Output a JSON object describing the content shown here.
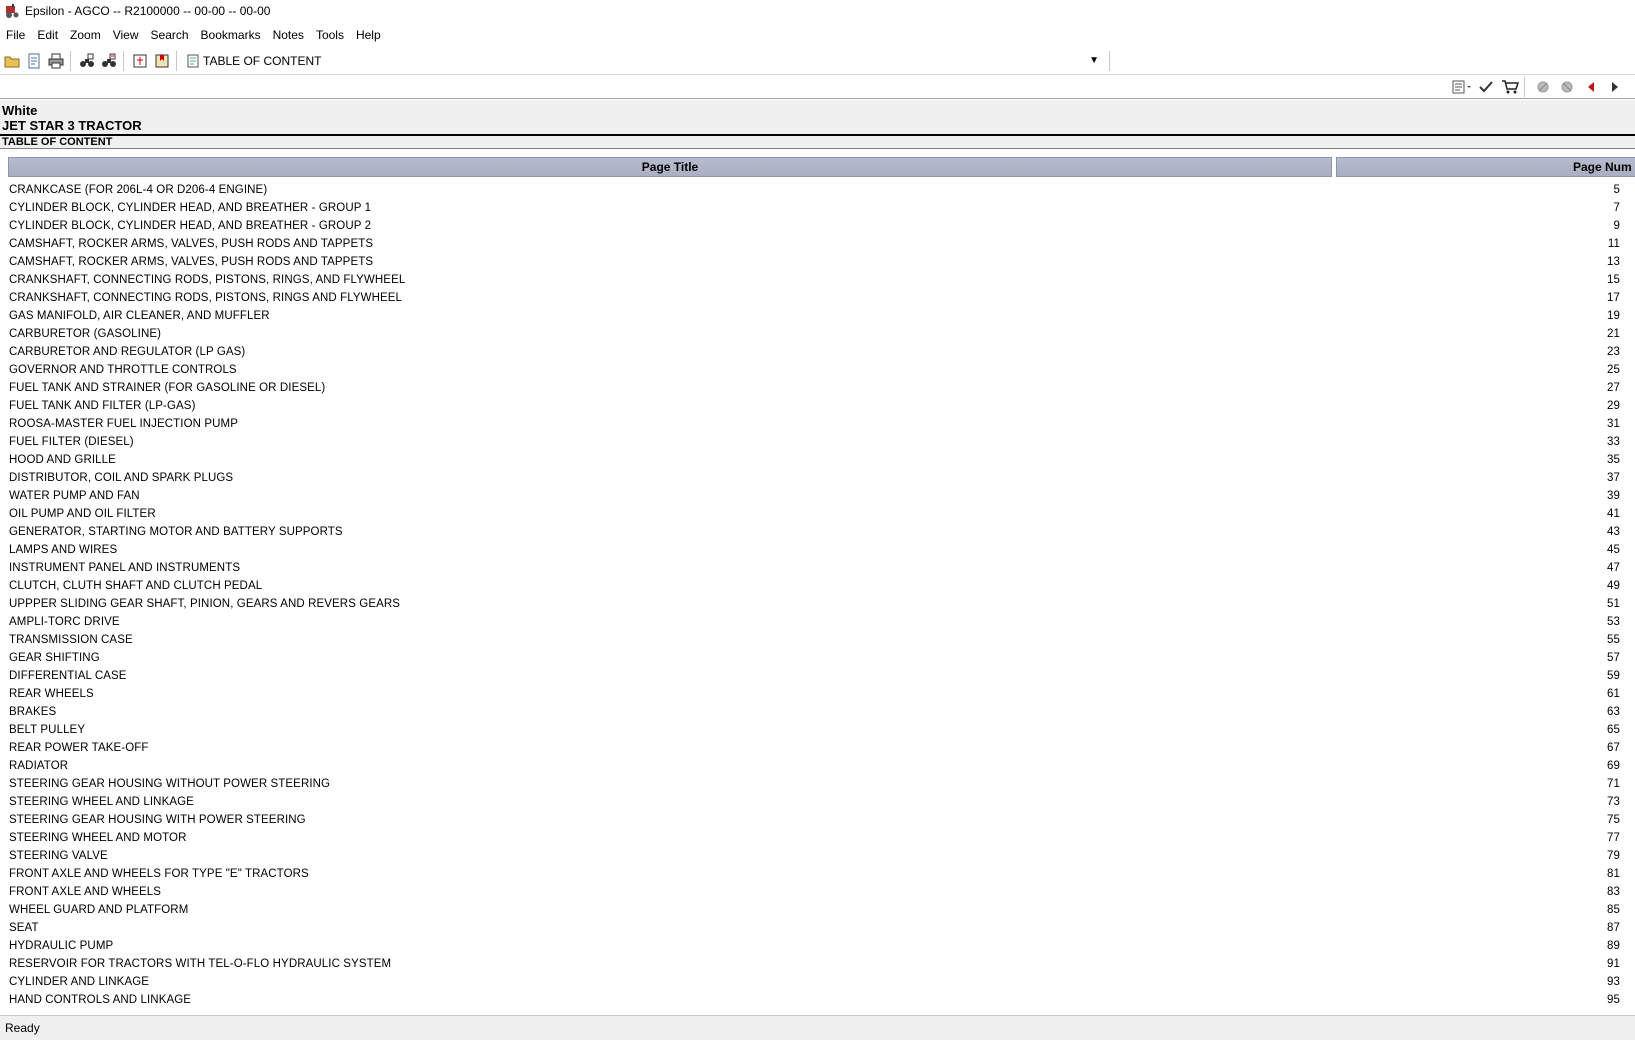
{
  "window": {
    "title": "Epsilon - AGCO -- R2100000 -- 00-00 -- 00-00"
  },
  "menu": [
    {
      "label": "File"
    },
    {
      "label": "Edit"
    },
    {
      "label": "Zoom"
    },
    {
      "label": "View"
    },
    {
      "label": "Search"
    },
    {
      "label": "Bookmarks"
    },
    {
      "label": "Notes"
    },
    {
      "label": "Tools"
    },
    {
      "label": "Help"
    }
  ],
  "toolbar": {
    "document_selector": "TABLE OF CONTENT",
    "icons": [
      "open-folder-icon",
      "save-icon",
      "print-icon",
      "binoculars-icon",
      "binoculars-next-icon",
      "book-icon",
      "bookmark-book-icon"
    ]
  },
  "nav_toolbar": {
    "icons": [
      "notes-dropdown-icon",
      "check-icon",
      "cart-icon",
      "parts-disabled-icon",
      "parts-disabled-2-icon",
      "prev-arrow-icon",
      "next-arrow-icon"
    ]
  },
  "header": {
    "brand": "White",
    "model": "JET STAR 3 TRACTOR",
    "section": "TABLE OF CONTENT"
  },
  "table": {
    "columns": [
      "Page Title",
      "Page Num"
    ],
    "rows": [
      {
        "title": "CRANKCASE (FOR 206L-4 OR D206-4 ENGINE)",
        "page": "5"
      },
      {
        "title": "CYLINDER BLOCK, CYLINDER HEAD, AND BREATHER - GROUP 1",
        "page": "7"
      },
      {
        "title": "CYLINDER BLOCK, CYLINDER HEAD, AND BREATHER - GROUP 2",
        "page": "9"
      },
      {
        "title": "CAMSHAFT, ROCKER ARMS, VALVES, PUSH RODS AND TAPPETS",
        "page": "11"
      },
      {
        "title": "CAMSHAFT, ROCKER ARMS, VALVES, PUSH RODS AND TAPPETS",
        "page": "13"
      },
      {
        "title": "CRANKSHAFT, CONNECTING RODS, PISTONS, RINGS, AND FLYWHEEL",
        "page": "15"
      },
      {
        "title": "CRANKSHAFT, CONNECTING RODS, PISTONS, RINGS AND FLYWHEEL",
        "page": "17"
      },
      {
        "title": "GAS MANIFOLD, AIR CLEANER, AND MUFFLER",
        "page": "19"
      },
      {
        "title": "CARBURETOR (GASOLINE)",
        "page": "21"
      },
      {
        "title": "CARBURETOR AND REGULATOR (LP GAS)",
        "page": "23"
      },
      {
        "title": "GOVERNOR AND THROTTLE CONTROLS",
        "page": "25"
      },
      {
        "title": "FUEL TANK AND STRAINER (FOR GASOLINE OR DIESEL)",
        "page": "27"
      },
      {
        "title": "FUEL TANK AND FILTER (LP-GAS)",
        "page": "29"
      },
      {
        "title": "ROOSA-MASTER FUEL INJECTION PUMP",
        "page": "31"
      },
      {
        "title": "FUEL FILTER (DIESEL)",
        "page": "33"
      },
      {
        "title": "HOOD AND GRILLE",
        "page": "35"
      },
      {
        "title": "DISTRIBUTOR, COIL AND SPARK PLUGS",
        "page": "37"
      },
      {
        "title": "WATER PUMP AND FAN",
        "page": "39"
      },
      {
        "title": "OIL PUMP AND OIL FILTER",
        "page": "41"
      },
      {
        "title": "GENERATOR, STARTING MOTOR AND BATTERY SUPPORTS",
        "page": "43"
      },
      {
        "title": "LAMPS AND WIRES",
        "page": "45"
      },
      {
        "title": "INSTRUMENT PANEL AND INSTRUMENTS",
        "page": "47"
      },
      {
        "title": "CLUTCH, CLUTH SHAFT AND CLUTCH PEDAL",
        "page": "49"
      },
      {
        "title": "UPPPER SLIDING GEAR SHAFT, PINION, GEARS AND REVERS GEARS",
        "page": "51"
      },
      {
        "title": "AMPLI-TORC DRIVE",
        "page": "53"
      },
      {
        "title": "TRANSMISSION CASE",
        "page": "55"
      },
      {
        "title": "GEAR SHIFTING",
        "page": "57"
      },
      {
        "title": "DIFFERENTIAL CASE",
        "page": "59"
      },
      {
        "title": "REAR WHEELS",
        "page": "61"
      },
      {
        "title": "BRAKES",
        "page": "63"
      },
      {
        "title": "BELT PULLEY",
        "page": "65"
      },
      {
        "title": "REAR POWER TAKE-OFF",
        "page": "67"
      },
      {
        "title": "RADIATOR",
        "page": "69"
      },
      {
        "title": "STEERING GEAR HOUSING WITHOUT POWER STEERING",
        "page": "71"
      },
      {
        "title": "STEERING WHEEL AND LINKAGE",
        "page": "73"
      },
      {
        "title": "STEERING GEAR HOUSING WITH POWER STEERING",
        "page": "75"
      },
      {
        "title": "STEERING WHEEL AND MOTOR",
        "page": "77"
      },
      {
        "title": "STEERING VALVE",
        "page": "79"
      },
      {
        "title": "FRONT AXLE AND WHEELS FOR TYPE \"E\" TRACTORS",
        "page": "81"
      },
      {
        "title": "FRONT AXLE AND WHEELS",
        "page": "83"
      },
      {
        "title": "WHEEL GUARD AND PLATFORM",
        "page": "85"
      },
      {
        "title": "SEAT",
        "page": "87"
      },
      {
        "title": "HYDRAULIC PUMP",
        "page": "89"
      },
      {
        "title": "RESERVOIR FOR TRACTORS WITH TEL-O-FLO HYDRAULIC SYSTEM",
        "page": "91"
      },
      {
        "title": "CYLINDER AND LINKAGE",
        "page": "93"
      },
      {
        "title": "HAND CONTROLS AND LINKAGE",
        "page": "95"
      }
    ]
  },
  "status": {
    "text": "Ready"
  }
}
